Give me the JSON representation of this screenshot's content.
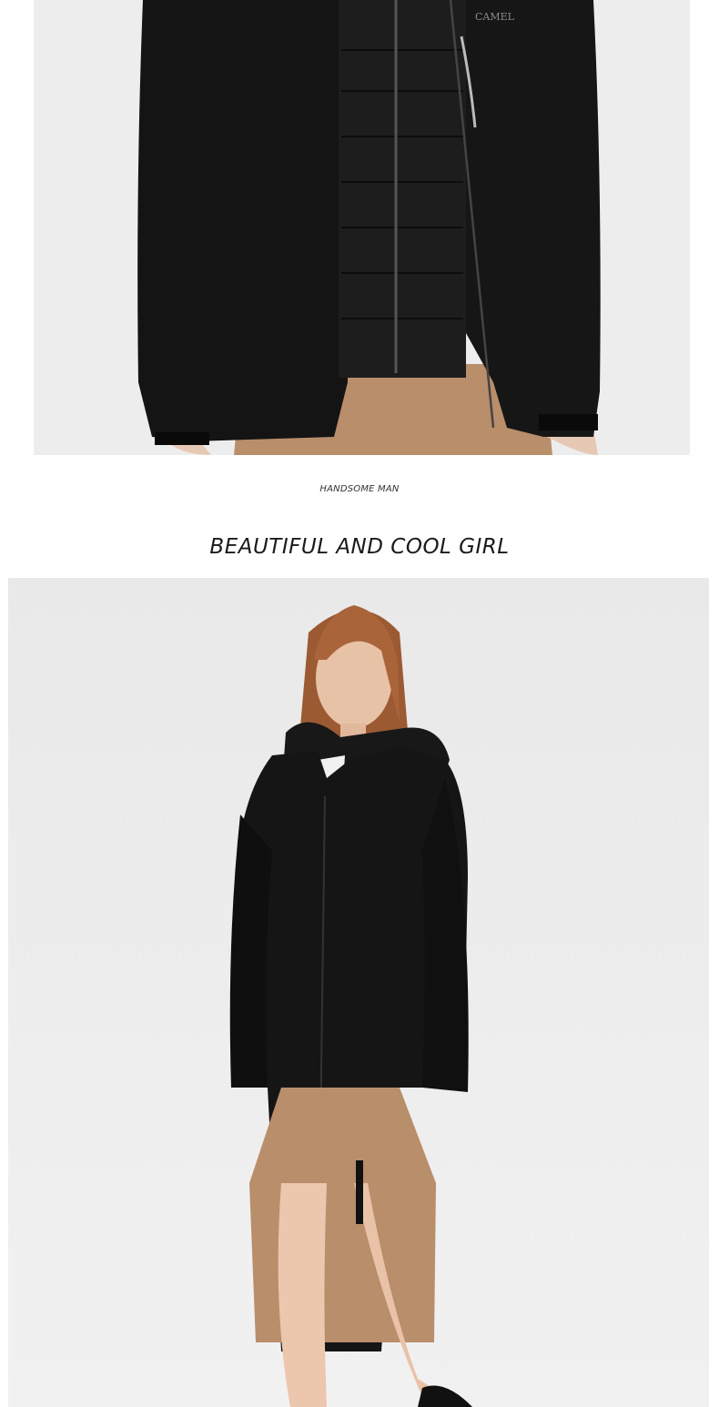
{
  "top_photo": {
    "brand_mark": "CAMEL"
  },
  "caption": "HANDSOME MAN",
  "section_title": "BEAUTIFUL AND COOL GIRL",
  "colors": {
    "background": "#ffffff",
    "photo_backdrop": "#ededed",
    "jacket": "#111111",
    "skirt": "#b98e6b"
  }
}
